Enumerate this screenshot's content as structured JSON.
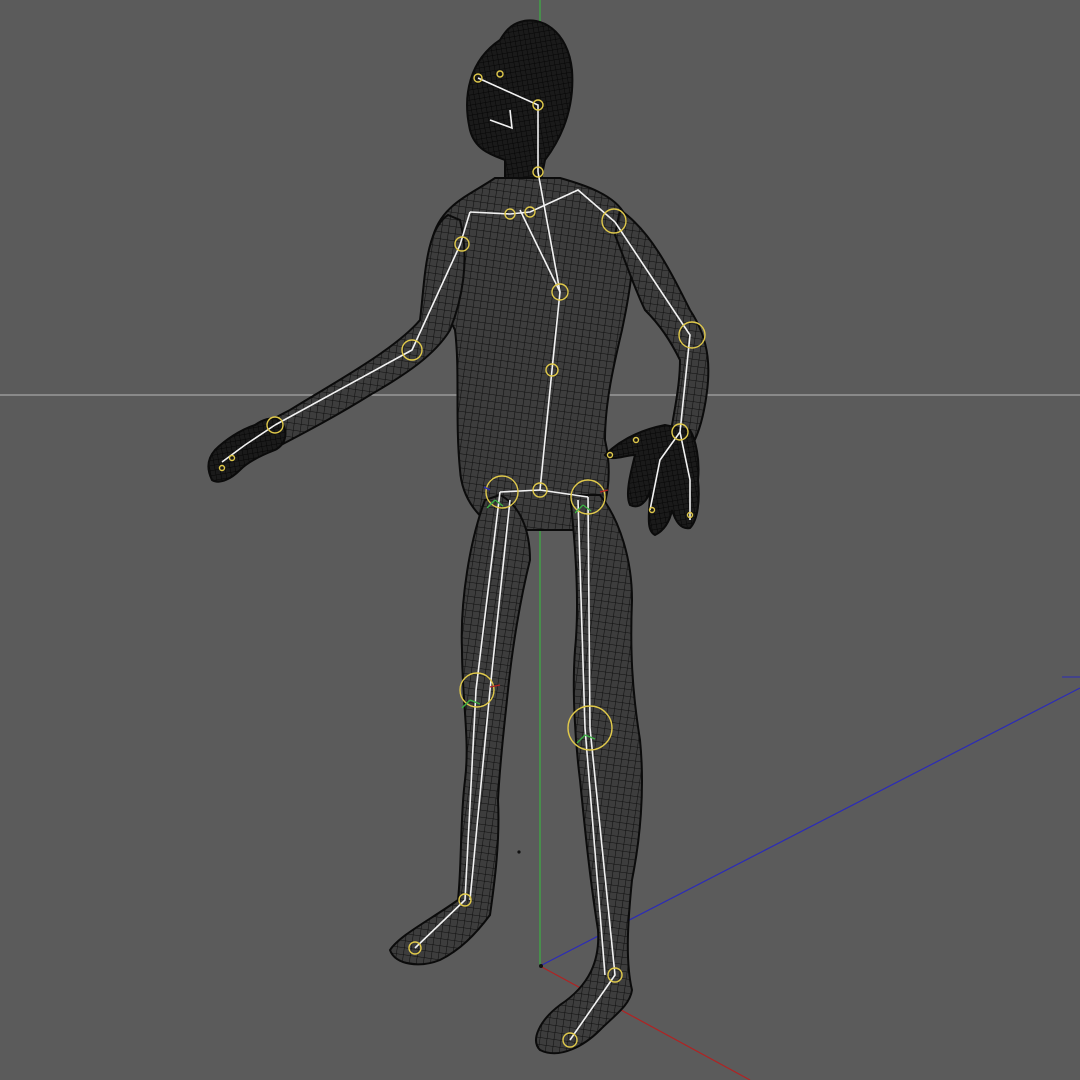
{
  "viewport": {
    "background": "#5b5b5b",
    "axis_colors": {
      "x": "#b22222",
      "y": "#3cb043",
      "z": "#2b2bb8"
    },
    "horizon_line_color": "#b9b9b9",
    "mesh_color": "#141414",
    "bone_color": "#f2f2f2",
    "joint_color": "#e0c94a"
  },
  "model": {
    "icon": "rigged-human-wireframe-icon",
    "display_mode": "wireframe",
    "skeleton_visible": true
  }
}
